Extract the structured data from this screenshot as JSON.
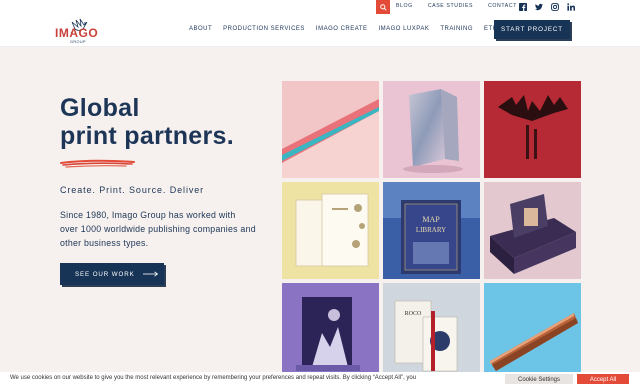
{
  "topbar": {
    "links": [
      "BLOG",
      "CASE STUDIES",
      "CONTACT"
    ],
    "search_icon": "search-icon",
    "social_icons": [
      "facebook-icon",
      "twitter-icon",
      "instagram-icon",
      "linkedin-icon"
    ]
  },
  "header": {
    "logo_text": "IMAGO",
    "logo_sub": "GROUP",
    "nav": [
      "ABOUT",
      "PRODUCTION SERVICES",
      "IMAGO CREATE",
      "IMAGO LUXPAK",
      "TRAINING",
      "ETHICS"
    ],
    "cta_label": "START PROJECT"
  },
  "hero": {
    "title_line1": "Global",
    "title_line2": "print partners.",
    "tagline": "Create. Print. Source. Deliver",
    "description": "Since 1980, Imago Group has worked with over 1000 worldwide publishing companies and other business types.",
    "button_label": "SEE OUR WORK"
  },
  "cookie": {
    "text": "We use cookies on our website to give you the most relevant experience by remembering your preferences and repeat visits. By clicking “Accept All”, you",
    "settings_label": "Cookie Settings",
    "accept_label": "Accept All"
  },
  "colors": {
    "navy": "#173456",
    "accent_red": "#e34b38",
    "background": "#f6f1ee"
  }
}
